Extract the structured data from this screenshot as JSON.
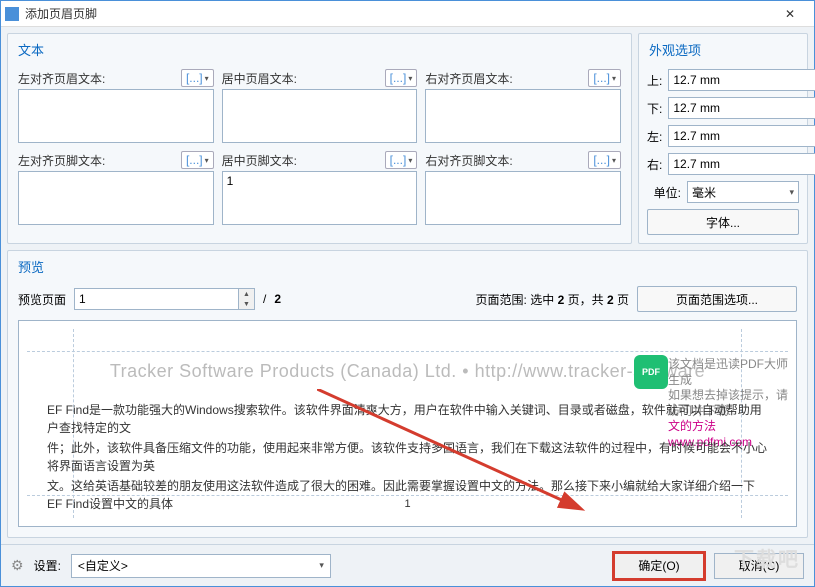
{
  "window": {
    "title": "添加页眉页脚",
    "close_label": "✕"
  },
  "text_panel": {
    "header": "文本",
    "fields": [
      {
        "label": "左对齐页眉文本:",
        "value": ""
      },
      {
        "label": "居中页眉文本:",
        "value": ""
      },
      {
        "label": "右对齐页眉文本:",
        "value": ""
      },
      {
        "label": "左对齐页脚文本:",
        "value": ""
      },
      {
        "label": "居中页脚文本:",
        "value": "1"
      },
      {
        "label": "右对齐页脚文本:",
        "value": ""
      }
    ],
    "macro_btn": "[...]"
  },
  "appearance": {
    "header": "外观选项",
    "margins": [
      {
        "label": "上:",
        "value": "12.7 mm"
      },
      {
        "label": "下:",
        "value": "12.7 mm"
      },
      {
        "label": "左:",
        "value": "12.7 mm"
      },
      {
        "label": "右:",
        "value": "12.7 mm"
      }
    ],
    "unit_label": "单位:",
    "unit_value": "毫米",
    "font_label": "字体..."
  },
  "preview": {
    "header": "预览",
    "page_label": "预览页面",
    "page_value": "1",
    "total_sep": "/",
    "total": "2",
    "range_prefix": "页面范围:",
    "range_selected": "选中",
    "range_total": "页，共",
    "range_suffix": "页",
    "range_count1": "2",
    "range_count2": "2",
    "range_btn": "页面范围选项...",
    "watermark": "Tracker Software Products (Canada) Ltd. • http://www.tracker-software",
    "pdf_badge": "PDF",
    "note1": "该文档是迅读PDF大师生成",
    "note2": "如果想去掉该提示，请访问并下载:",
    "note3": "文的方法www.pdfmi.com",
    "doc_line1": "EF Find是一款功能强大的Windows搜索软件。该软件界面清爽大方，用户在软件中输入关键词、目录或者磁盘，软件就可以自动帮助用户查找特定的文",
    "doc_line2": "件；此外，该软件具备压缩文件的功能，使用起来非常方便。该软件支持多国语言，我们在下载这法软件的过程中，有时候可能会不小心将界面语言设置为英",
    "doc_line3": "文。这给英语基础较差的朋友使用这法软件造成了很大的困难。因此需要掌握设置中文的方法。那么接下来小编就给大家详细介绍一下EF Find设置中文的具体",
    "page_number_display": "1"
  },
  "footer": {
    "settings_label": "设置:",
    "preset_value": "<自定义>",
    "ok": "确定(O)",
    "cancel": "取消(C)"
  },
  "bg_logo": "下载吧"
}
